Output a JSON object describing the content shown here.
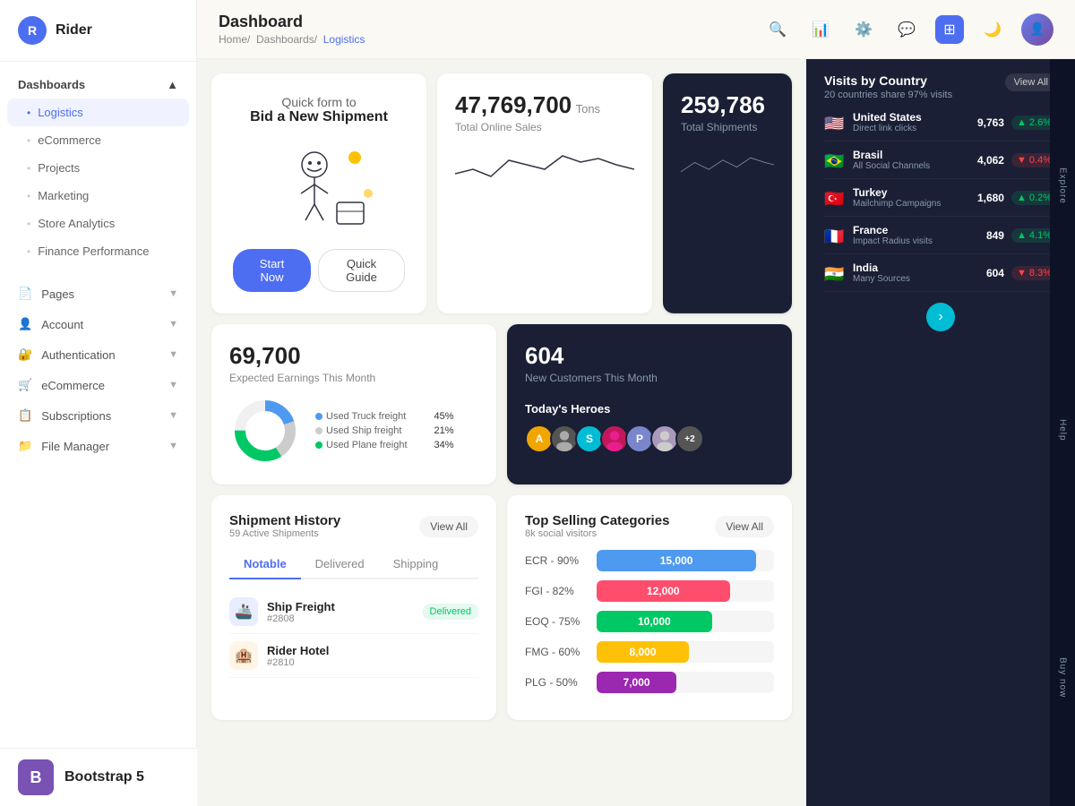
{
  "logo": {
    "letter": "R",
    "name": "Rider"
  },
  "sidebar": {
    "dashboards_label": "Dashboards",
    "items": [
      {
        "label": "Logistics",
        "active": true
      },
      {
        "label": "eCommerce",
        "active": false
      },
      {
        "label": "Projects",
        "active": false
      },
      {
        "label": "Marketing",
        "active": false
      },
      {
        "label": "Store Analytics",
        "active": false
      },
      {
        "label": "Finance Performance",
        "active": false
      }
    ],
    "bottom_items": [
      {
        "label": "Pages",
        "icon": "📄"
      },
      {
        "label": "Account",
        "icon": "👤"
      },
      {
        "label": "Authentication",
        "icon": "🔐"
      },
      {
        "label": "eCommerce",
        "icon": "🛒"
      },
      {
        "label": "Subscriptions",
        "icon": "📋"
      },
      {
        "label": "File Manager",
        "icon": "📁"
      }
    ]
  },
  "header": {
    "title": "Dashboard",
    "breadcrumb": [
      "Home",
      "Dashboards",
      "Logistics"
    ]
  },
  "promo_card": {
    "subtitle": "Quick form to",
    "title": "Bid a New Shipment",
    "btn_primary": "Start Now",
    "btn_secondary": "Quick Guide"
  },
  "stats": {
    "total_sales_number": "47,769,700",
    "total_sales_unit": "Tons",
    "total_sales_label": "Total Online Sales",
    "total_shipments_number": "259,786",
    "total_shipments_label": "Total Shipments",
    "earnings_number": "69,700",
    "earnings_label": "Expected Earnings This Month",
    "customers_number": "604",
    "customers_label": "New Customers This Month"
  },
  "freight": {
    "truck_label": "Used Truck freight",
    "truck_pct": "45%",
    "ship_label": "Used Ship freight",
    "ship_pct": "21%",
    "plane_label": "Used Plane freight",
    "plane_pct": "34%"
  },
  "heroes": {
    "title": "Today's Heroes",
    "avatars": [
      {
        "letter": "A",
        "color": "#f0a500"
      },
      {
        "letter": "S",
        "color": "#4e9af1"
      },
      {
        "letter": "S",
        "color": "#00bcd4"
      },
      {
        "letter": "P",
        "color": "#e91e8c"
      },
      {
        "letter": "",
        "color": "#aa99bb"
      },
      {
        "letter": "+2",
        "color": "#555"
      }
    ]
  },
  "countries": {
    "title": "Visits by Country",
    "subtitle": "20 countries share 97% visits",
    "view_all_label": "View All",
    "list": [
      {
        "name": "United States",
        "source": "Direct link clicks",
        "visits": "9,763",
        "change": "+2.6%",
        "up": true,
        "flag": "🇺🇸"
      },
      {
        "name": "Brasil",
        "source": "All Social Channels",
        "visits": "4,062",
        "change": "-0.4%",
        "up": false,
        "flag": "🇧🇷"
      },
      {
        "name": "Turkey",
        "source": "Mailchimp Campaigns",
        "visits": "1,680",
        "change": "+0.2%",
        "up": true,
        "flag": "🇹🇷"
      },
      {
        "name": "France",
        "source": "Impact Radius visits",
        "visits": "849",
        "change": "+4.1%",
        "up": true,
        "flag": "🇫🇷"
      },
      {
        "name": "India",
        "source": "Many Sources",
        "visits": "604",
        "change": "-8.3%",
        "up": false,
        "flag": "🇮🇳"
      }
    ]
  },
  "shipment_history": {
    "title": "Shipment History",
    "subtitle": "59 Active Shipments",
    "view_all": "View All",
    "tabs": [
      "Notable",
      "Delivered",
      "Shipping"
    ],
    "active_tab": 0,
    "items": [
      {
        "name": "Ship Freight",
        "id": "#2808",
        "status": "Delivered",
        "icon": "🚢"
      }
    ]
  },
  "categories": {
    "title": "Top Selling Categories",
    "subtitle": "8k social visitors",
    "view_all": "View All",
    "bars": [
      {
        "label": "ECR - 90%",
        "value": 15000,
        "display": "15,000",
        "color": "#4e9af1",
        "width": "90%"
      },
      {
        "label": "FGI - 82%",
        "value": 12000,
        "display": "12,000",
        "color": "#ff4d6d",
        "width": "75%"
      },
      {
        "label": "EOQ - 75%",
        "value": 10000,
        "display": "10,000",
        "color": "#00c864",
        "width": "65%"
      },
      {
        "label": "FMG - 60%",
        "value": 8000,
        "display": "8,000",
        "color": "#ffc107",
        "width": "52%"
      },
      {
        "label": "PLG - 50%",
        "value": 7000,
        "display": "7,000",
        "color": "#9c27b0",
        "width": "45%"
      }
    ]
  },
  "explore_labels": [
    "Explore",
    "Help",
    "Buy now"
  ],
  "bootstrap": {
    "letter": "B",
    "text": "Bootstrap 5"
  }
}
